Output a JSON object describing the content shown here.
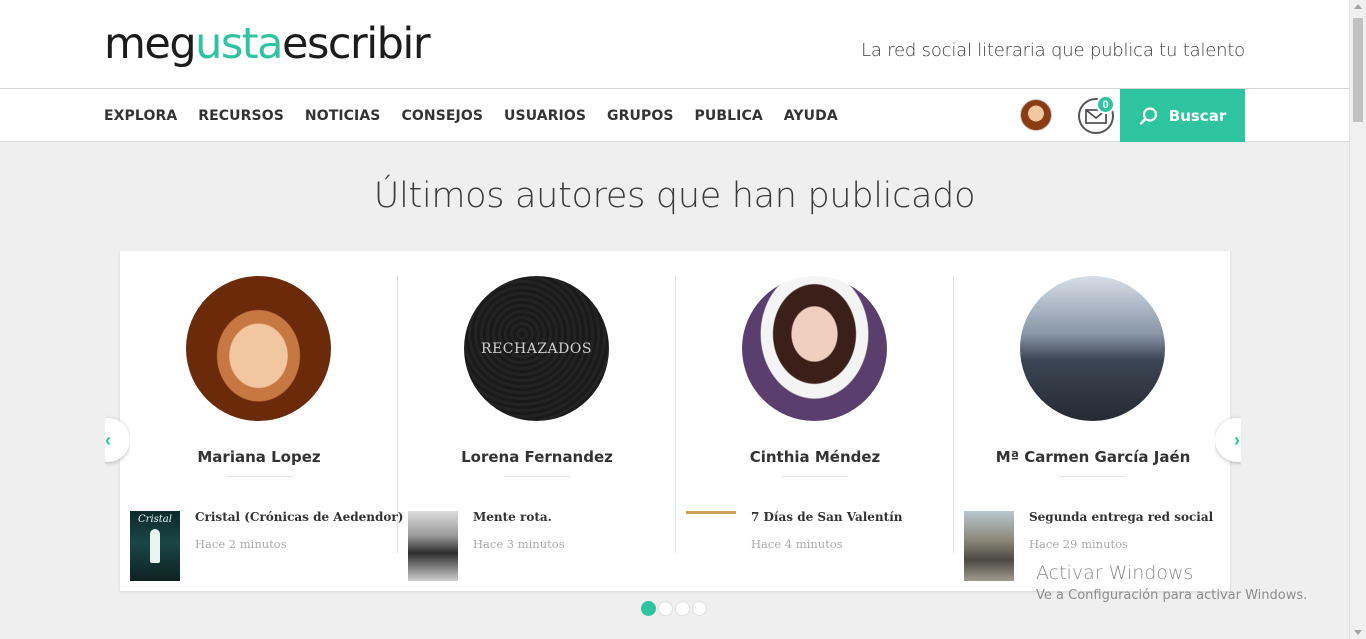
{
  "header": {
    "logo": {
      "part1": "meg",
      "accent": "usta",
      "part2": "escribir"
    },
    "tagline": "La red social literaria que publica tu talento"
  },
  "nav": {
    "items": [
      "EXPLORA",
      "RECURSOS",
      "NOTICIAS",
      "CONSEJOS",
      "USUARIOS",
      "GRUPOS",
      "PUBLICA",
      "AYUDA"
    ],
    "messages_count": "0",
    "search_label": "Buscar"
  },
  "colors": {
    "accent": "#2ec4a0"
  },
  "section": {
    "title": "Últimos autores que han publicado",
    "authors": [
      {
        "name": "Mariana Lopez",
        "book": "Cristal (Crónicas de Aedendor)",
        "time": "Hace 2 minutos",
        "cover_text": "Cristal"
      },
      {
        "name": "Lorena Fernandez",
        "book": "Mente rota.",
        "time": "Hace 3 minutos",
        "portrait_text": "RECHAZADOS"
      },
      {
        "name": "Cinthia Méndez",
        "book": "7 Días de San Valentín",
        "time": "Hace 4 minutos"
      },
      {
        "name": "Mª Carmen García Jaén",
        "book": "Segunda entrega red social",
        "time": "Hace 29 minutos"
      }
    ],
    "prev_icon": "chevron-left-icon",
    "next_icon": "chevron-right-icon",
    "pages": 4,
    "active_page": 1
  },
  "watermark": {
    "line1": "Activar Windows",
    "line2": "Ve a Configuración para activar Windows."
  }
}
